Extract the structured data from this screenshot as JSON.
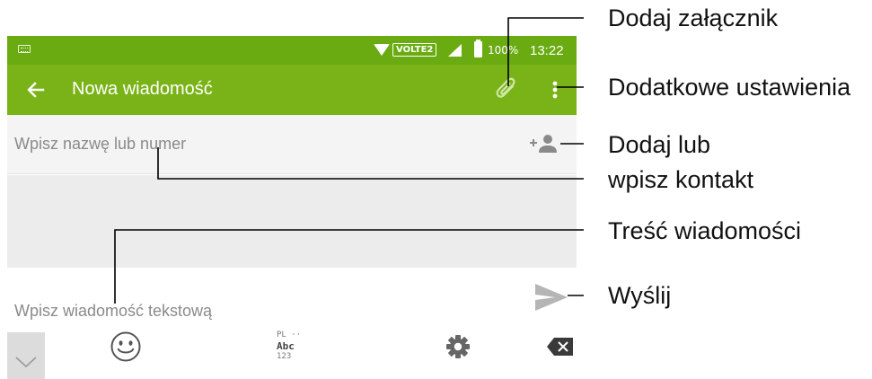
{
  "status_bar": {
    "network_badge": "VOLTE2",
    "battery_percent": "100%",
    "time": "13:22"
  },
  "app_bar": {
    "title": "Nowa wiadomość",
    "icons": [
      "back-arrow-icon",
      "paperclip-icon",
      "more-vertical-icon"
    ]
  },
  "recipient": {
    "placeholder": "Wpisz nazwę lub numer",
    "icon": "add-contact-icon"
  },
  "compose": {
    "placeholder": "Wpisz wiadomość tekstową",
    "icon": "send-icon"
  },
  "keyboard_bar": {
    "language_lines": [
      "PL ··",
      "Abc",
      "123"
    ],
    "icons": [
      "keyboard-hide-icon",
      "emoji-icon",
      "settings-gear-icon",
      "backspace-icon"
    ]
  },
  "callouts": {
    "attach": "Dodaj załącznik",
    "more_settings": "Dodatkowe ustawienia",
    "contact_line1": "Dodaj lub",
    "contact_line2": "wpisz kontakt",
    "message_body": "Treść wiadomości",
    "send": "Wyślij"
  },
  "colors": {
    "status_bar": "#6aab12",
    "app_bar": "#7ab317",
    "placeholder_text": "#8a8a8a",
    "thread_area": "#ececec"
  }
}
